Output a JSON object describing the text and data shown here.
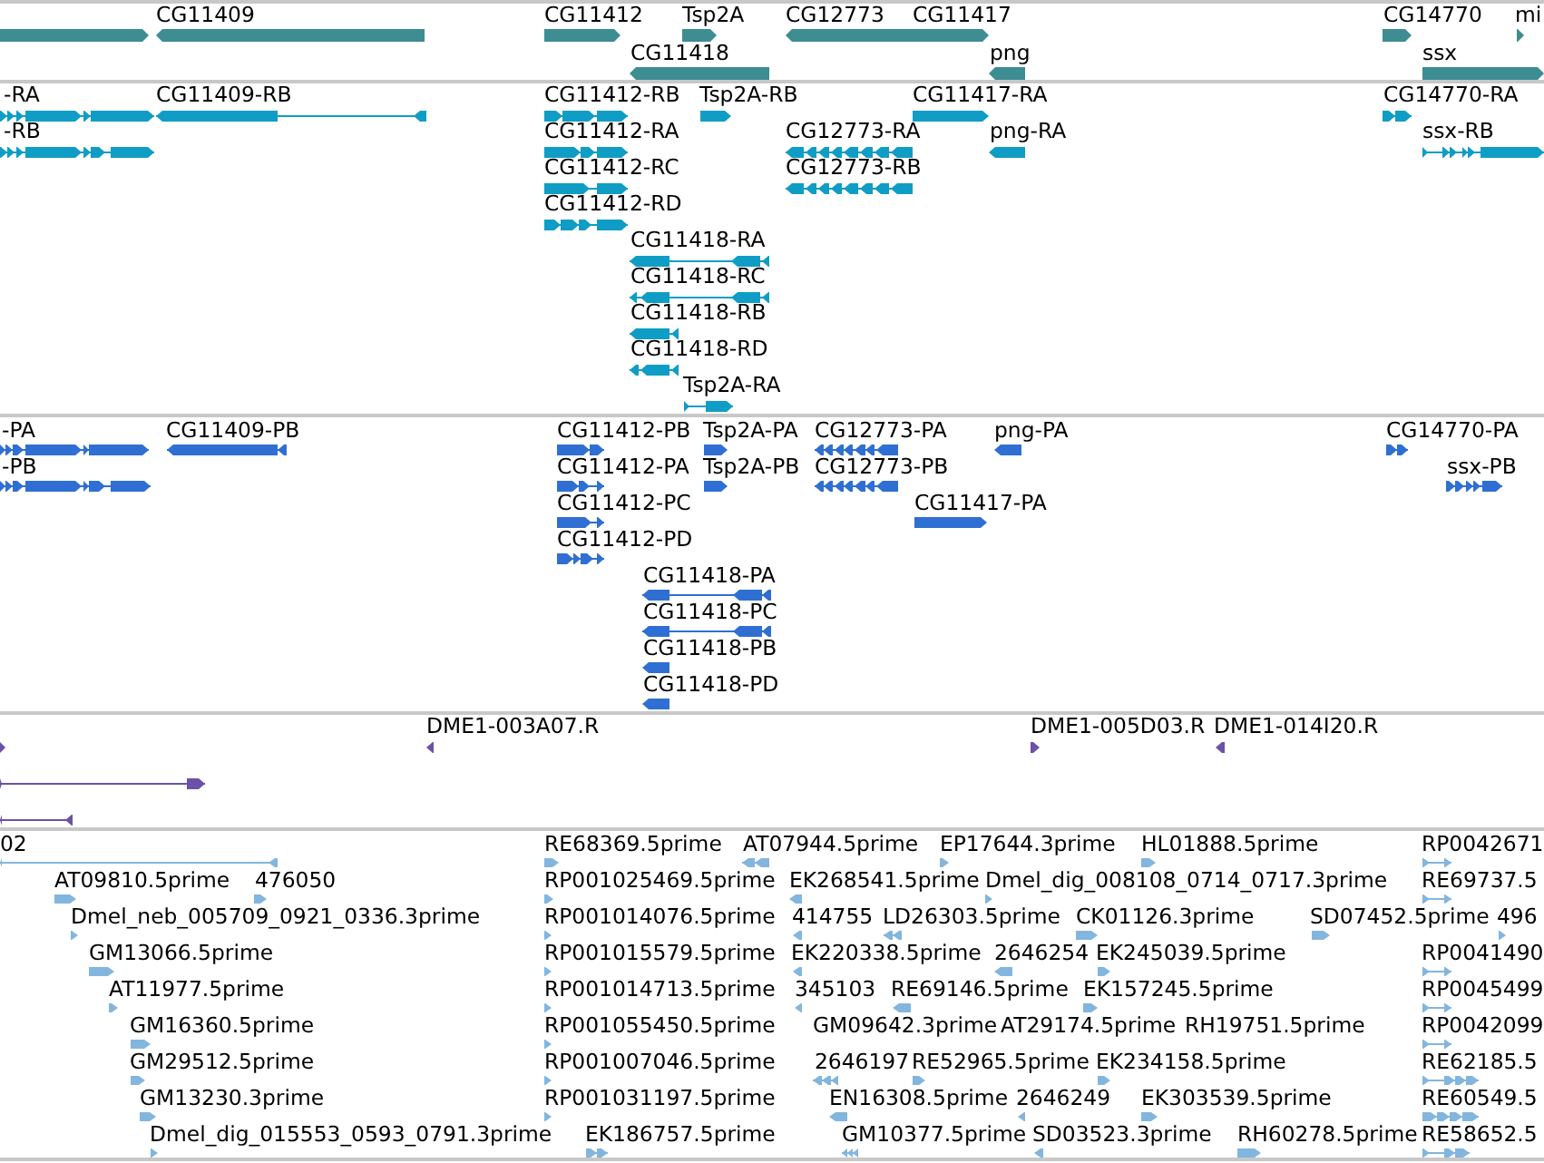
{
  "tracks": [
    {
      "kind": "gene",
      "features": [
        {
          "reverse": false
        },
        {
          "label": "CG11409",
          "reverse": true
        },
        {
          "label": "CG11412",
          "reverse": false
        },
        {
          "label": "Tsp2A",
          "reverse": false
        },
        {
          "label": "CG12773",
          "reverse": true
        },
        {
          "label": "CG11417",
          "reverse": false
        },
        {
          "label": "CG14770",
          "reverse": false
        },
        {
          "label": "mi",
          "reverse": false
        },
        {
          "label": "CG11418",
          "reverse": true
        },
        {
          "label": "png",
          "reverse": true
        },
        {
          "label": "ssx",
          "reverse": false
        }
      ]
    },
    {
      "kind": "transcript",
      "features": [
        {
          "label": "-RA",
          "reverse": false
        },
        {
          "label": "CG11409-RB",
          "reverse": true
        },
        {
          "label": "CG11412-RB",
          "reverse": false
        },
        {
          "label": "Tsp2A-RB",
          "reverse": false
        },
        {
          "label": "CG11417-RA",
          "reverse": false
        },
        {
          "label": "CG14770-RA",
          "reverse": false
        },
        {
          "label": "-RB",
          "reverse": false
        },
        {
          "label": "CG11412-RA",
          "reverse": false
        },
        {
          "label": "CG12773-RA",
          "reverse": true
        },
        {
          "label": "png-RA",
          "reverse": true
        },
        {
          "label": "ssx-RB",
          "reverse": false
        },
        {
          "label": "CG11412-RC",
          "reverse": false
        },
        {
          "label": "CG12773-RB",
          "reverse": true
        },
        {
          "label": "CG11412-RD",
          "reverse": false
        },
        {
          "label": "CG11418-RA",
          "reverse": true
        },
        {
          "label": "CG11418-RC",
          "reverse": true
        },
        {
          "label": "CG11418-RB",
          "reverse": true
        },
        {
          "label": "CG11418-RD",
          "reverse": true
        },
        {
          "label": "Tsp2A-RA",
          "reverse": false
        }
      ]
    },
    {
      "kind": "protein",
      "features": [
        {
          "label": "-PA",
          "reverse": false
        },
        {
          "label": "CG11409-PB",
          "reverse": true
        },
        {
          "label": "CG11412-PB",
          "reverse": false
        },
        {
          "label": "Tsp2A-PA",
          "reverse": false
        },
        {
          "label": "CG12773-PA",
          "reverse": true
        },
        {
          "label": "png-PA",
          "reverse": true
        },
        {
          "label": "CG14770-PA",
          "reverse": false
        },
        {
          "label": "-PB",
          "reverse": false
        },
        {
          "label": "CG11412-PA",
          "reverse": false
        },
        {
          "label": "Tsp2A-PB",
          "reverse": false
        },
        {
          "label": "CG12773-PB",
          "reverse": true
        },
        {
          "label": "ssx-PB",
          "reverse": false
        },
        {
          "label": "CG11412-PC",
          "reverse": false
        },
        {
          "label": "CG11417-PA",
          "reverse": false
        },
        {
          "label": "CG11412-PD",
          "reverse": false
        },
        {
          "label": "CG11418-PA",
          "reverse": true
        },
        {
          "label": "CG11418-PC",
          "reverse": true
        },
        {
          "label": "CG11418-PB",
          "reverse": true
        },
        {
          "label": "CG11418-PD",
          "reverse": true
        }
      ]
    },
    {
      "kind": "bac_end",
      "features": [
        {
          "reverse": false
        },
        {
          "label": "DME1-003A07.R",
          "reverse": true
        },
        {
          "label": "DME1-005D03.R",
          "reverse": false
        },
        {
          "label": "DME1-014I20.R",
          "reverse": true
        },
        {
          "reverse": false
        },
        {
          "reverse": true
        }
      ]
    },
    {
      "kind": "est",
      "features": [
        {
          "label": "02",
          "reverse": true
        },
        {
          "label": "RE68369.5prime",
          "reverse": false
        },
        {
          "label": "AT07944.5prime",
          "reverse": true
        },
        {
          "label": "EP17644.3prime",
          "reverse": false
        },
        {
          "label": "HL01888.5prime",
          "reverse": false
        },
        {
          "label": "RP0042671",
          "reverse": false
        },
        {
          "label": "AT09810.5prime",
          "reverse": false
        },
        {
          "label": "476050",
          "reverse": false
        },
        {
          "label": "RP001025469.5prime",
          "reverse": false
        },
        {
          "label": "EK268541.5prime",
          "reverse": true
        },
        {
          "label": "Dmel_dig_008108_0714_0717.3prime",
          "reverse": false
        },
        {
          "label": "RE69737.5",
          "reverse": false
        },
        {
          "label": "Dmel_neb_005709_0921_0336.3prime",
          "reverse": false
        },
        {
          "label": "RP001014076.5prime",
          "reverse": false
        },
        {
          "label": "414755",
          "reverse": true
        },
        {
          "label": "LD26303.5prime",
          "reverse": true
        },
        {
          "label": "CK01126.3prime",
          "reverse": false
        },
        {
          "label": "SD07452.5prime",
          "reverse": false
        },
        {
          "label": "496",
          "reverse": false
        },
        {
          "label": "GM13066.5prime",
          "reverse": false
        },
        {
          "label": "RP001015579.5prime",
          "reverse": false
        },
        {
          "label": "EK220338.5prime",
          "reverse": true
        },
        {
          "label": "2646254",
          "reverse": true
        },
        {
          "label": "EK245039.5prime",
          "reverse": false
        },
        {
          "label": "RP0041490",
          "reverse": false
        },
        {
          "label": "AT11977.5prime",
          "reverse": false
        },
        {
          "label": "RP001014713.5prime",
          "reverse": false
        },
        {
          "label": "345103",
          "reverse": true
        },
        {
          "label": "RE69146.5prime",
          "reverse": true
        },
        {
          "label": "EK157245.5prime",
          "reverse": false
        },
        {
          "label": "RP0045499",
          "reverse": false
        },
        {
          "label": "GM16360.5prime",
          "reverse": false
        },
        {
          "label": "RP001055450.5prime",
          "reverse": false
        },
        {
          "label": "GM09642.3prime"
        },
        {
          "label": "AT29174.5prime"
        },
        {
          "label": "RH19751.5prime"
        },
        {
          "label": "RP0042099",
          "reverse": false
        },
        {
          "label": "GM29512.5prime",
          "reverse": false
        },
        {
          "label": "RP001007046.5prime",
          "reverse": false
        },
        {
          "label": "2646197",
          "reverse": true
        },
        {
          "label": "RE52965.5prime",
          "reverse": false
        },
        {
          "label": "EK234158.5prime",
          "reverse": false
        },
        {
          "label": "RE62185.5",
          "reverse": false
        },
        {
          "label": "GM13230.3prime",
          "reverse": false
        },
        {
          "label": "RP001031197.5prime",
          "reverse": false
        },
        {
          "label": "EN16308.5prime",
          "reverse": true
        },
        {
          "label": "2646249",
          "reverse": true
        },
        {
          "label": "EK303539.5prime",
          "reverse": false
        },
        {
          "label": "RE60549.5",
          "reverse": false
        },
        {
          "label": "Dmel_dig_015553_0593_0791.3prime",
          "reverse": false
        },
        {
          "label": "EK186757.5prime",
          "reverse": false
        },
        {
          "label": "GM10377.5prime",
          "reverse": true
        },
        {
          "label": "SD03523.3prime",
          "reverse": true
        },
        {
          "label": "RH60278.5prime",
          "reverse": false
        },
        {
          "label": "RE58652.5",
          "reverse": false
        }
      ]
    }
  ]
}
